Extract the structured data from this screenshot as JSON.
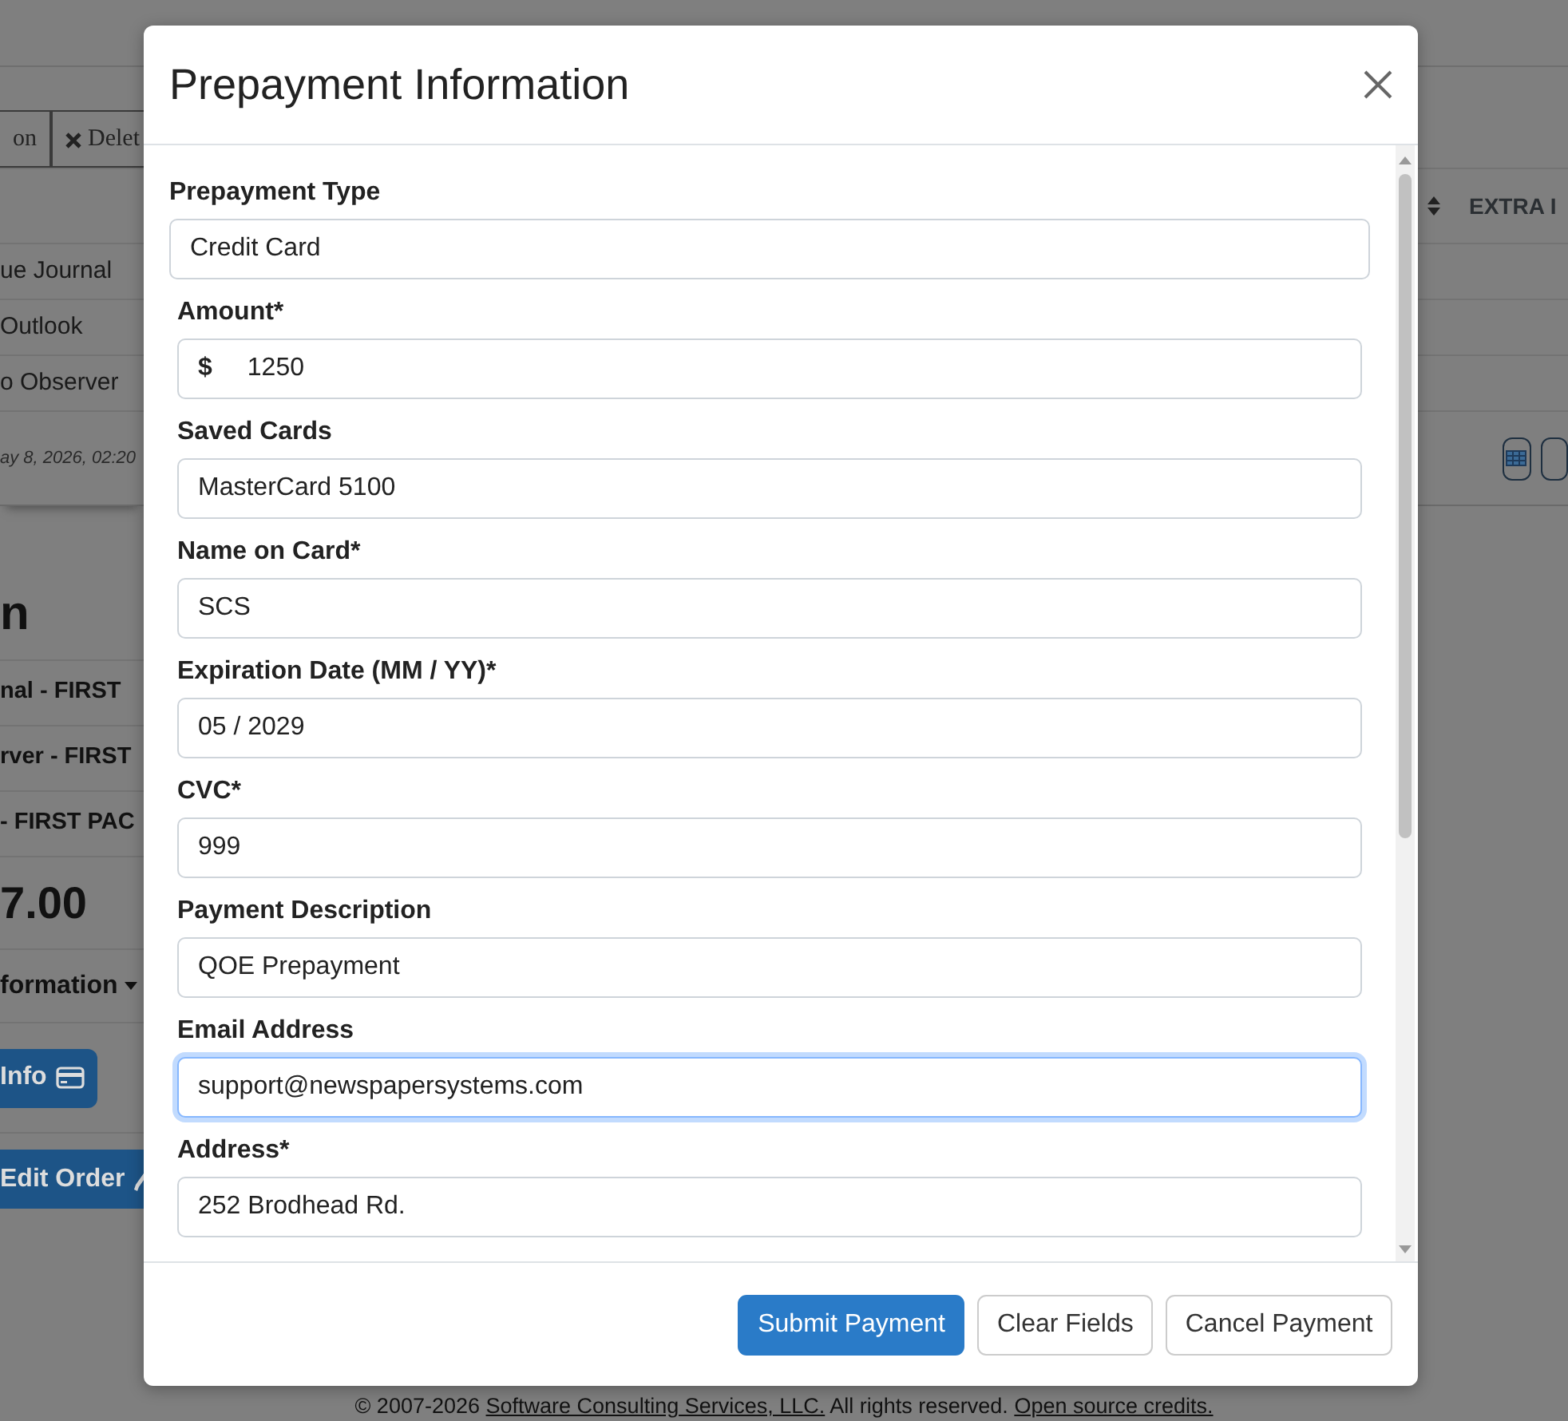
{
  "background": {
    "toolbar": [
      {
        "label": "on",
        "icon": false
      },
      {
        "label": "Delet",
        "icon": true
      }
    ],
    "table": {
      "column_extra": "EXTRA I",
      "rows": [
        {
          "column_1": "ue Journal"
        },
        {
          "column_1": "Outlook"
        },
        {
          "column_1": "o Observer"
        }
      ],
      "timestamp": "ay 8, 2026, 02:20"
    },
    "order": {
      "heading": "n",
      "items": [
        "nal - FIRST",
        "rver - FIRST",
        "- FIRST PAC"
      ],
      "total": "7.00",
      "dropdown": "formation",
      "info_button": "Info",
      "edit_button": "Edit Order"
    }
  },
  "modal": {
    "title": "Prepayment Information",
    "fields": [
      {
        "label": "Prepayment Type",
        "value": "Credit Card",
        "kind": "select",
        "focused": false
      },
      {
        "label": "Amount*",
        "value": "1250",
        "prefix": "$",
        "kind": "input",
        "focused": false
      },
      {
        "label": "Saved Cards",
        "value": "MasterCard 5100",
        "kind": "input",
        "focused": false
      },
      {
        "label": "Name on Card*",
        "value": "SCS",
        "kind": "input",
        "focused": false
      },
      {
        "label": "Expiration Date (MM / YY)*",
        "value": "05 / 2029",
        "kind": "input",
        "focused": false
      },
      {
        "label": "CVC*",
        "value": "999",
        "kind": "input",
        "focused": false
      },
      {
        "label": "Payment Description",
        "value": "QOE Prepayment",
        "kind": "input",
        "focused": false
      },
      {
        "label": "Email Address",
        "value": "support@newspapersystems.com",
        "kind": "input",
        "focused": true
      },
      {
        "label": "Address*",
        "value": "252 Brodhead Rd.",
        "kind": "input",
        "focused": false
      }
    ],
    "buttons": [
      {
        "label": "Submit Payment",
        "primary": true
      },
      {
        "label": "Clear Fields",
        "primary": false
      },
      {
        "label": "Cancel Payment",
        "primary": false
      }
    ]
  },
  "footer": {
    "copyright": "© 2007-2026",
    "company_link": "Software Consulting Services, LLC.",
    "rights": "All rights reserved.",
    "credits_link": "Open source credits."
  }
}
